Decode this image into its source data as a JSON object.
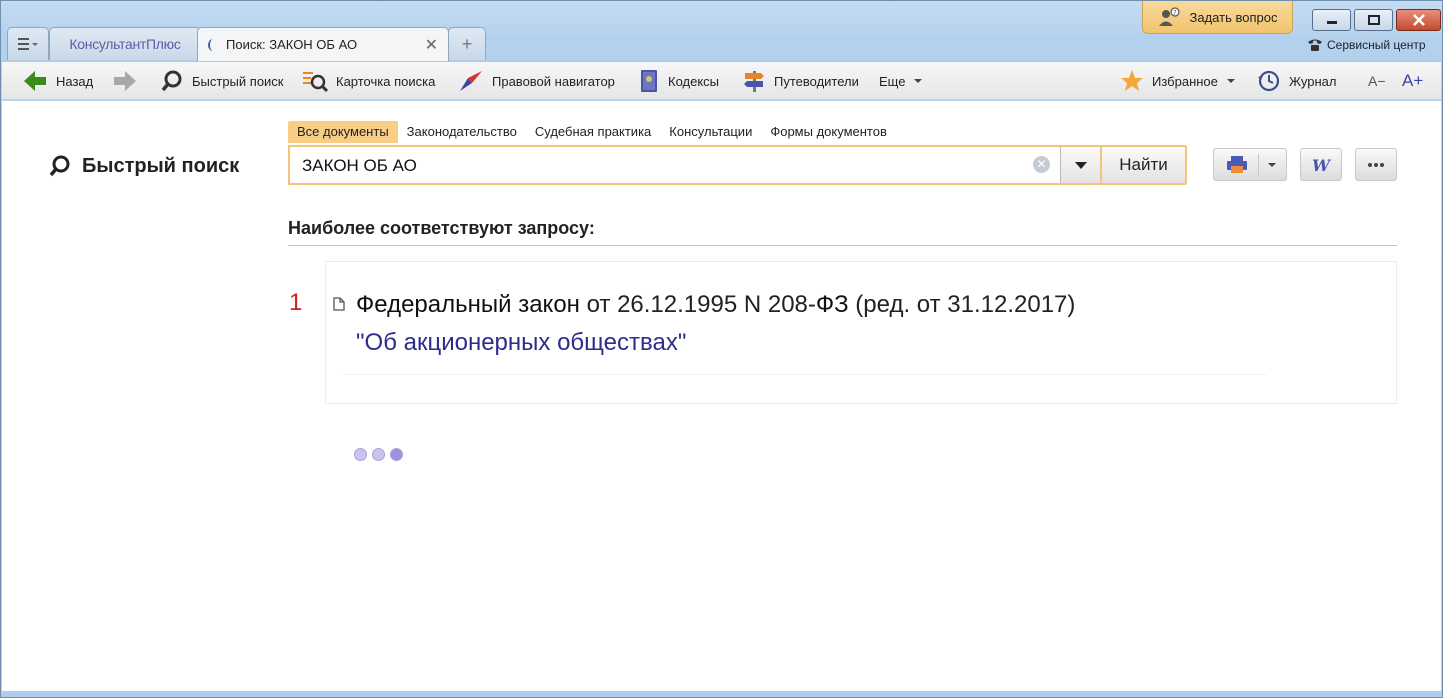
{
  "tabs": {
    "logo_label": "КонсультантПлюс",
    "active_title": "Поиск: ЗАКОН ОБ АО",
    "close_glyph": "✕",
    "new_tab_glyph": "+"
  },
  "header": {
    "ask_question": "Задать вопрос",
    "service_center": "Сервисный центр"
  },
  "toolbar": {
    "back": "Назад",
    "quick_search": "Быстрый поиск",
    "search_card": "Карточка поиска",
    "legal_navigator": "Правовой навигатор",
    "codes": "Кодексы",
    "guides": "Путеводители",
    "more": "Еще",
    "favorites": "Избранное",
    "journal": "Журнал",
    "font_smaller": "A−",
    "font_larger": "A+"
  },
  "search": {
    "page_title": "Быстрый поиск",
    "tabs": [
      "Все документы",
      "Законодательство",
      "Судебная практика",
      "Консультации",
      "Формы документов"
    ],
    "query": "ЗАКОН ОБ АО",
    "find_button": "Найти"
  },
  "results": {
    "heading": "Наиболее соответствуют запросу:",
    "items": [
      {
        "number": "1",
        "line1_bold": "Федеральный закон",
        "line1_rest_a": " от 26.12.1995 N 208-",
        "line1_bold2": "ФЗ",
        "line1_rest_b": " (ред. от 31.12.2017)",
        "line2_a": "\"Об ",
        "line2_bold": "акционерных обществах",
        "line2_b": "\""
      }
    ]
  },
  "colors": {
    "accent_orange": "#f3c57a",
    "result_number": "#d42020",
    "result_title_link": "#2c2c8c"
  }
}
